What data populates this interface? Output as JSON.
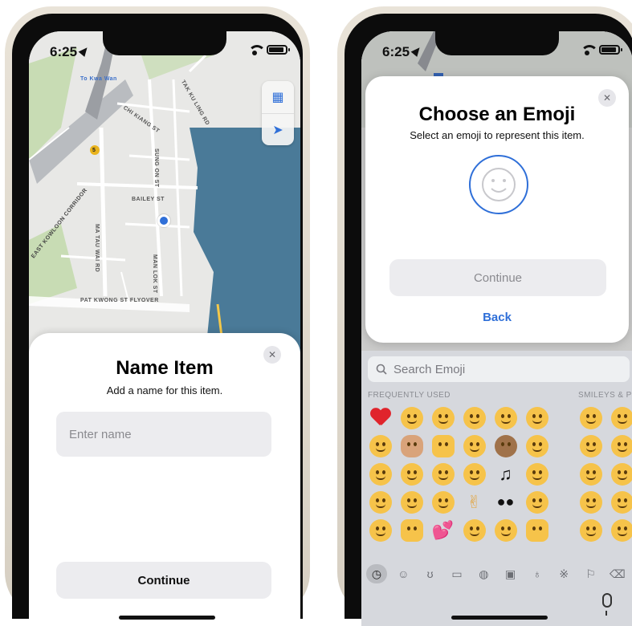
{
  "status_bar": {
    "time": "6:25"
  },
  "left_screen": {
    "map_labels": [
      "To Kwa Wan",
      "EAST KOWLOON CORRIDOR",
      "MA TAU WAI RD",
      "BAILEY ST",
      "PAT KWONG ST FLYOVER",
      "MAN LOK ST",
      "CHI KIANG ST",
      "SUNG ON ST",
      "TAK KU LING RD",
      "5"
    ],
    "sheet": {
      "title": "Name Item",
      "subtitle": "Add a name for this item.",
      "name_placeholder": "Enter name",
      "name_value": "",
      "continue_label": "Continue",
      "close_icon": "close-icon"
    }
  },
  "right_screen": {
    "card": {
      "title": "Choose an Emoji",
      "subtitle": "Select an emoji to represent this item.",
      "selected_emoji_icon": "smiley-placeholder-icon",
      "continue_label": "Continue",
      "back_label": "Back"
    },
    "keyboard": {
      "search_placeholder": "Search Emoji",
      "section_frequently_used": "FREQUENTLY USED",
      "section_smileys": "SMILEYS & P",
      "categories": [
        "clock-icon",
        "smiley-icon",
        "animal-icon",
        "food-icon",
        "ball-icon",
        "car-icon",
        "lightbulb-icon",
        "symbols-icon",
        "flag-icon"
      ],
      "delete_icon": "backspace-icon",
      "mic_icon": "microphone-icon"
    }
  },
  "colors": {
    "accent_blue": "#2f6fd8",
    "button_gray": "#ececef",
    "water": "#4a7a98",
    "park": "#c8dcb4"
  }
}
